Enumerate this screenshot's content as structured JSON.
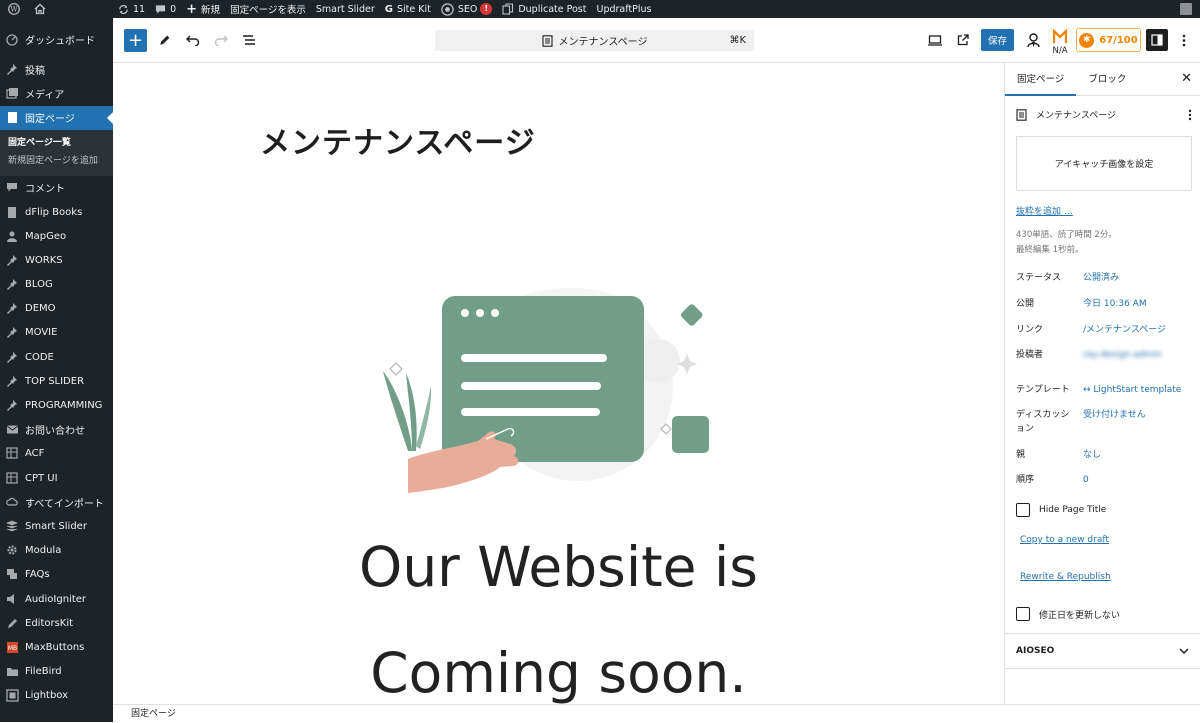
{
  "adminbar": {
    "updates_count": "11",
    "comments_count": "0",
    "new_label": "新規",
    "view_page_label": "固定ページを表示",
    "smart_slider": "Smart Slider",
    "site_kit": "Site Kit",
    "seo": "SEO",
    "seo_badge": "!",
    "duplicate_post": "Duplicate Post",
    "updraftplus": "UpdraftPlus"
  },
  "menu": {
    "items": [
      {
        "label": "ダッシュボード",
        "icon": "dashboard-icon"
      },
      {
        "label": "投稿",
        "icon": "pin-icon"
      },
      {
        "label": "メディア",
        "icon": "media-icon"
      },
      {
        "label": "固定ページ",
        "icon": "page-icon",
        "current": true
      },
      {
        "label": "コメント",
        "icon": "comment-icon"
      },
      {
        "label": "dFlip Books",
        "icon": "book-icon"
      },
      {
        "label": "MapGeo",
        "icon": "person-icon"
      },
      {
        "label": "WORKS",
        "icon": "pin-icon"
      },
      {
        "label": "BLOG",
        "icon": "pin-icon"
      },
      {
        "label": "DEMO",
        "icon": "pin-icon"
      },
      {
        "label": "MOVIE",
        "icon": "pin-icon"
      },
      {
        "label": "CODE",
        "icon": "pin-icon"
      },
      {
        "label": "TOP SLIDER",
        "icon": "pin-icon"
      },
      {
        "label": "PROGRAMMING",
        "icon": "pin-icon"
      },
      {
        "label": "お問い合わせ",
        "icon": "mail-icon"
      },
      {
        "label": "ACF",
        "icon": "grid-icon"
      },
      {
        "label": "CPT UI",
        "icon": "grid-icon"
      },
      {
        "label": "すべてインポート",
        "icon": "cloud-icon"
      },
      {
        "label": "Smart Slider",
        "icon": "slider-icon"
      },
      {
        "label": "Modula",
        "icon": "gear-icon"
      },
      {
        "label": "FAQs",
        "icon": "chat-icon"
      },
      {
        "label": "AudioIgniter",
        "icon": "speaker-icon"
      },
      {
        "label": "EditorsKit",
        "icon": "pencil-icon"
      },
      {
        "label": "MaxButtons",
        "icon": "maxbuttons-icon"
      },
      {
        "label": "FileBird",
        "icon": "folder-icon"
      },
      {
        "label": "Lightbox",
        "icon": "lightbox-icon"
      }
    ],
    "submenu": [
      "固定ページ一覧",
      "新規固定ページを追加"
    ]
  },
  "toolbar": {
    "command_title": "メンテナンスページ",
    "shortcut": "⌘K",
    "save_label": "保存",
    "na_label": "N/A",
    "score_label": "67/100"
  },
  "content": {
    "page_title": "メンテナンスページ",
    "heading_line1": "Our Website is",
    "heading_line2": "Coming soon."
  },
  "statusbar": {
    "breadcrumb": "固定ページ"
  },
  "sidebar": {
    "tab_page": "固定ページ",
    "tab_block": "ブロック",
    "doc_title": "メンテナンスページ",
    "featured_image": "アイキャッチ画像を設定",
    "excerpt_link": "抜粋を追加 …",
    "word_count": "430単語、読了時間 2分。",
    "last_edited": "最終編集 1秒前。",
    "rows": [
      {
        "label": "ステータス",
        "value": "公開済み"
      },
      {
        "label": "公開",
        "value": "今日 10:36 AM"
      },
      {
        "label": "リンク",
        "value": "/メンテナンスページ"
      },
      {
        "label": "投稿者",
        "value": "ray-design-admin"
      },
      {
        "label": "テンプレート",
        "value": "↔ LightStart template"
      },
      {
        "label": "ディスカッション",
        "value": "受け付けません"
      },
      {
        "label": "親",
        "value": "なし"
      },
      {
        "label": "順序",
        "value": "0"
      }
    ],
    "hide_title": "Hide Page Title",
    "copy_draft": "Copy to a new draft",
    "rewrite": "Rewrite & Republish",
    "no_update_date": "修正日を更新しない",
    "aioseo": "AIOSEO"
  }
}
